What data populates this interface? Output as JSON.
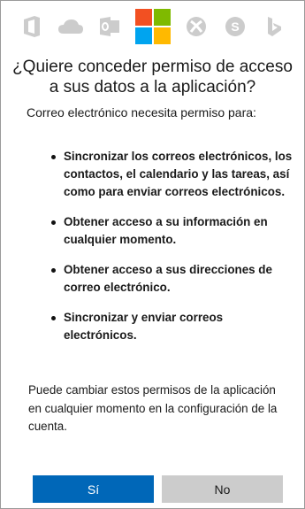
{
  "header": {
    "icons": [
      "office-icon",
      "onedrive-icon",
      "outlook-icon",
      "microsoft-logo-icon",
      "xbox-icon",
      "skype-icon",
      "bing-icon"
    ],
    "icon_color": "#cccccc"
  },
  "dialog": {
    "title": "¿Quiere conceder permiso de acceso a sus datos a la aplicación?",
    "intro": "Correo electrónico necesita permiso para:",
    "permissions": [
      "Sincronizar los correos electrónicos, los contactos, el calendario y las tareas, así como para enviar correos electrónicos.",
      "Obtener acceso a su información en cualquier momento.",
      "Obtener acceso a sus direcciones de correo electrónico.",
      "Sincronizar y enviar correos electrónicos."
    ],
    "footer": "Puede cambiar estos permisos de la aplicación en cualquier momento en la configuración de la cuenta."
  },
  "buttons": {
    "yes_label": "Sí",
    "no_label": "No",
    "yes_color": "#0067b8",
    "no_color": "#cccccc"
  }
}
